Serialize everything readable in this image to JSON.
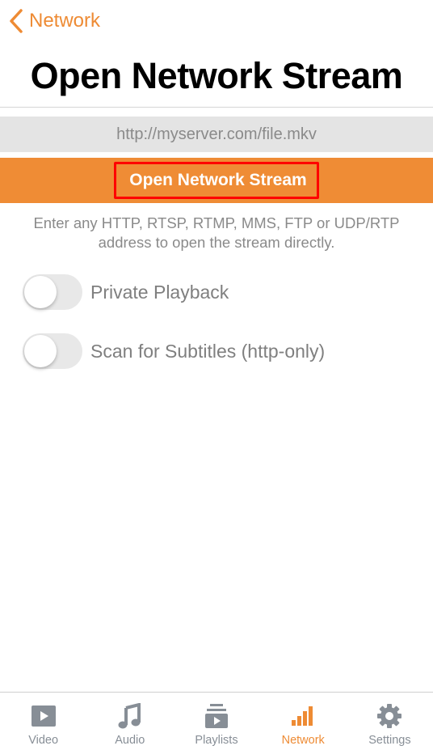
{
  "nav": {
    "back_label": "Network",
    "back_icon": "chevron-left-icon"
  },
  "header": {
    "title": "Open Network Stream"
  },
  "url_input": {
    "value": "",
    "placeholder": "http://myserver.com/file.mkv"
  },
  "open_button": {
    "label": "Open Network Stream"
  },
  "hint": "Enter any HTTP, RTSP, RTMP, MMS, FTP or UDP/RTP address to open the stream directly.",
  "toggles": [
    {
      "label": "Private Playback",
      "on": false
    },
    {
      "label": "Scan for Subtitles (http-only)",
      "on": false
    }
  ],
  "tabbar": {
    "items": [
      {
        "label": "Video",
        "icon": "video-icon",
        "active": false
      },
      {
        "label": "Audio",
        "icon": "music-note-icon",
        "active": false
      },
      {
        "label": "Playlists",
        "icon": "playlists-icon",
        "active": false
      },
      {
        "label": "Network",
        "icon": "signal-bars-icon",
        "active": true
      },
      {
        "label": "Settings",
        "icon": "gear-icon",
        "active": false
      }
    ]
  },
  "colors": {
    "accent": "#ee8b34",
    "inactive": "#878e96",
    "highlight_border": "#ff0000"
  }
}
